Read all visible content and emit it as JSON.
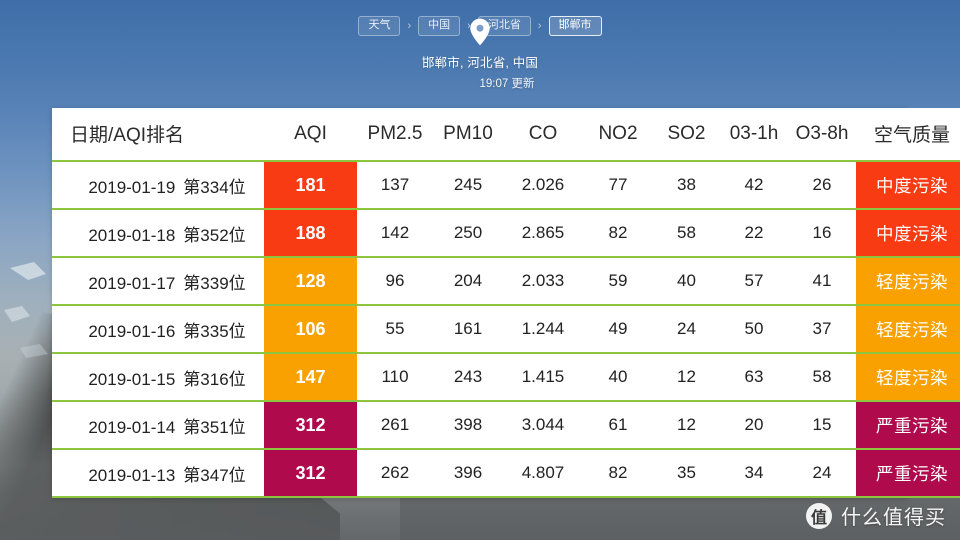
{
  "breadcrumb": {
    "items": [
      {
        "label": "天气",
        "current": false
      },
      {
        "label": "中国",
        "current": false
      },
      {
        "label": "河北省",
        "current": false
      },
      {
        "label": "邯郸市",
        "current": true
      }
    ],
    "separator": "›"
  },
  "location": {
    "pin_icon": "location-pin-icon",
    "name": "邯郸市, 河北省, 中国",
    "updated": "19:07 更新"
  },
  "table": {
    "headers": [
      "日期/AQI排名",
      "AQI",
      "PM2.5",
      "PM10",
      "CO",
      "NO2",
      "SO2",
      "03-1h",
      "O3-8h",
      "空气质量"
    ],
    "rows": [
      {
        "date": "2019-01-19",
        "rank": "第334位",
        "aqi": "181",
        "aqi_color": "#F93B13",
        "pm25": "137",
        "pm10": "245",
        "co": "2.026",
        "no2": "77",
        "so2": "38",
        "o3_1h": "42",
        "o3_8h": "26",
        "quality": "中度污染",
        "quality_color": "#F93B13"
      },
      {
        "date": "2019-01-18",
        "rank": "第352位",
        "aqi": "188",
        "aqi_color": "#F93B13",
        "pm25": "142",
        "pm10": "250",
        "co": "2.865",
        "no2": "82",
        "so2": "58",
        "o3_1h": "22",
        "o3_8h": "16",
        "quality": "中度污染",
        "quality_color": "#F93B13"
      },
      {
        "date": "2019-01-17",
        "rank": "第339位",
        "aqi": "128",
        "aqi_color": "#F8A100",
        "pm25": "96",
        "pm10": "204",
        "co": "2.033",
        "no2": "59",
        "so2": "40",
        "o3_1h": "57",
        "o3_8h": "41",
        "quality": "轻度污染",
        "quality_color": "#F8A100"
      },
      {
        "date": "2019-01-16",
        "rank": "第335位",
        "aqi": "106",
        "aqi_color": "#F8A100",
        "pm25": "55",
        "pm10": "161",
        "co": "1.244",
        "no2": "49",
        "so2": "24",
        "o3_1h": "50",
        "o3_8h": "37",
        "quality": "轻度污染",
        "quality_color": "#F8A100"
      },
      {
        "date": "2019-01-15",
        "rank": "第316位",
        "aqi": "147",
        "aqi_color": "#F8A100",
        "pm25": "110",
        "pm10": "243",
        "co": "1.415",
        "no2": "40",
        "so2": "12",
        "o3_1h": "63",
        "o3_8h": "58",
        "quality": "轻度污染",
        "quality_color": "#F8A100"
      },
      {
        "date": "2019-01-14",
        "rank": "第351位",
        "aqi": "312",
        "aqi_color": "#AF0B4C",
        "pm25": "261",
        "pm10": "398",
        "co": "3.044",
        "no2": "61",
        "so2": "12",
        "o3_1h": "20",
        "o3_8h": "15",
        "quality": "严重污染",
        "quality_color": "#AF0B4C"
      },
      {
        "date": "2019-01-13",
        "rank": "第347位",
        "aqi": "312",
        "aqi_color": "#AF0B4C",
        "pm25": "262",
        "pm10": "396",
        "co": "4.807",
        "no2": "82",
        "so2": "35",
        "o3_1h": "34",
        "o3_8h": "24",
        "quality": "严重污染",
        "quality_color": "#AF0B4C"
      }
    ]
  },
  "watermark": {
    "logo_text": "值",
    "text": "什么值得买"
  },
  "colors": {
    "row_divider": "#8CC63F",
    "moderate": "#F93B13",
    "light": "#F8A100",
    "severe": "#AF0B4C"
  }
}
